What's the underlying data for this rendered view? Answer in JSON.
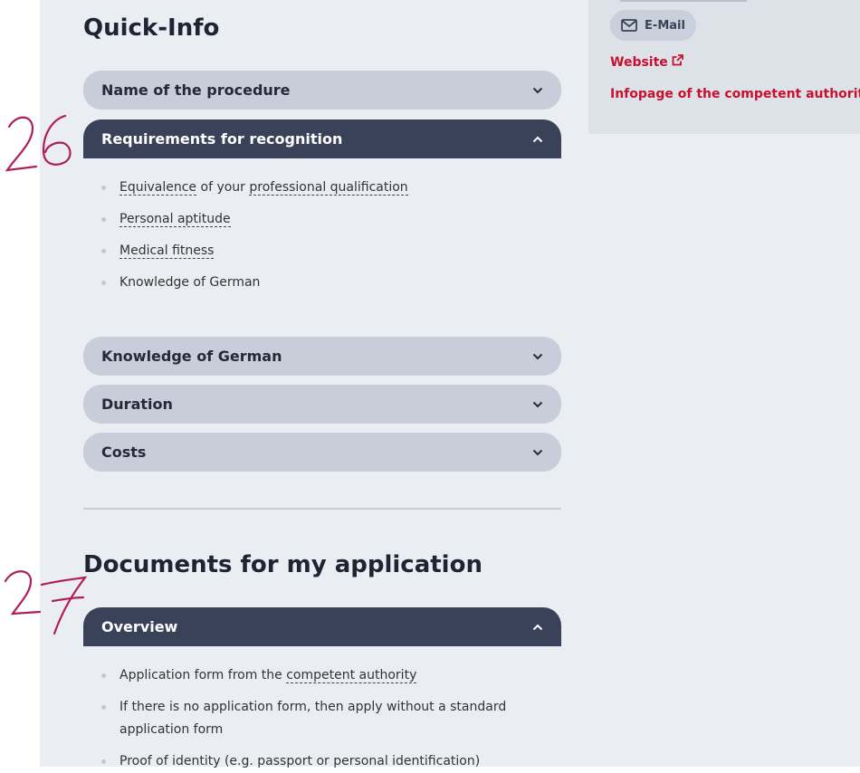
{
  "sidebar": {
    "email_label": "E-Mail",
    "website_label": "Website",
    "infopage_label": "Infopage of the competent authority"
  },
  "quick_info": {
    "title": "Quick-Info",
    "accordions": [
      {
        "label": "Name of the procedure",
        "state": "collapsed"
      },
      {
        "label": "Requirements for recognition",
        "state": "expanded"
      },
      {
        "label": "Knowledge of German",
        "state": "collapsed"
      },
      {
        "label": "Duration",
        "state": "collapsed"
      },
      {
        "label": "Costs",
        "state": "collapsed"
      }
    ],
    "requirements": {
      "item1": {
        "link1": "Equivalence",
        "mid": " of your ",
        "link2": "professional qualification"
      },
      "item2": "Personal aptitude",
      "item3": "Medical fitness",
      "item4": "Knowledge of German"
    }
  },
  "documents": {
    "title": "Documents for my application",
    "overview_label": "Overview",
    "items": {
      "item1": {
        "text": "Application form from the ",
        "link": "competent authority"
      },
      "item2_line1": "If there is no application form, then apply without a standard",
      "item2_line2": "application form",
      "item3": "Proof of identity (e.g. passport or personal identification)"
    }
  },
  "annotations": {
    "first": "26",
    "second": "27"
  },
  "colors": {
    "accordion_open": "#3a4259",
    "accordion_closed": "#c9cdd9",
    "link_red": "#c8102e",
    "annotation_ink": "#b01e5a"
  }
}
